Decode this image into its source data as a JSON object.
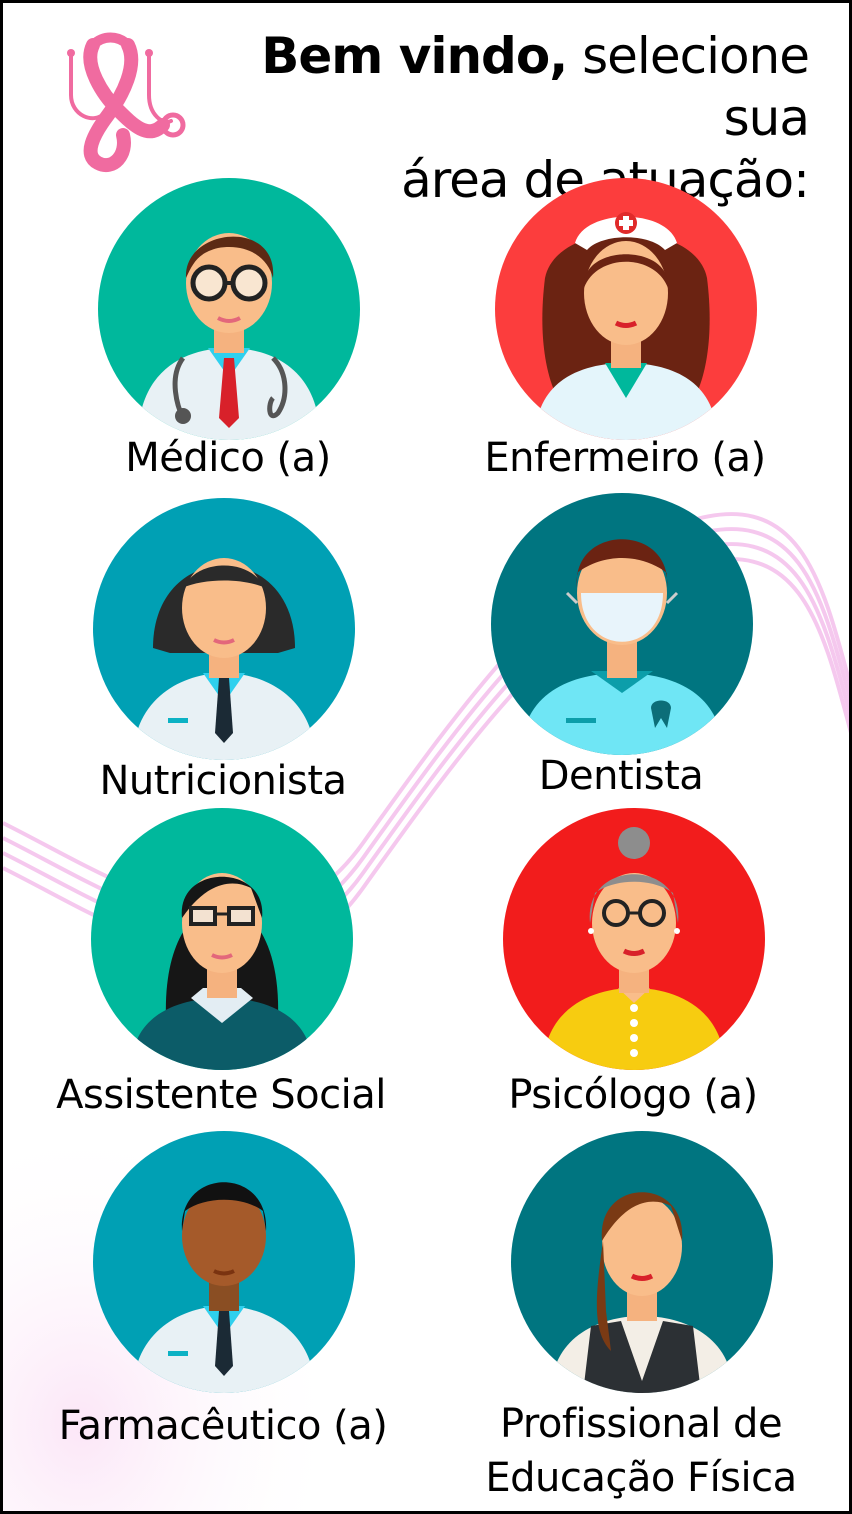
{
  "header": {
    "title_bold": "Bem vindo,",
    "title_rest_line1": "selecione sua",
    "title_line2": "área de atuação:"
  },
  "colors": {
    "brand_pink": "#f06ba0",
    "teal": "#00b89c",
    "dark_teal": "#007580",
    "cyan": "#00a0b4",
    "red": "#fc3d3d",
    "bright_red": "#f21c1c"
  },
  "professions": [
    {
      "label": "Médico (a)",
      "icon": "doctor-icon"
    },
    {
      "label": "Enfermeiro (a)",
      "icon": "nurse-icon"
    },
    {
      "label": "Nutricionista",
      "icon": "nutritionist-icon"
    },
    {
      "label": "Dentista",
      "icon": "dentist-icon"
    },
    {
      "label": "Assistente Social",
      "icon": "social-worker-icon"
    },
    {
      "label": "Psicólogo (a)",
      "icon": "psychologist-icon"
    },
    {
      "label": "Farmacêutico (a)",
      "icon": "pharmacist-icon"
    },
    {
      "label_line1": "Profissional de",
      "label_line2": "Educação Física",
      "icon": "physical-educator-icon"
    }
  ]
}
